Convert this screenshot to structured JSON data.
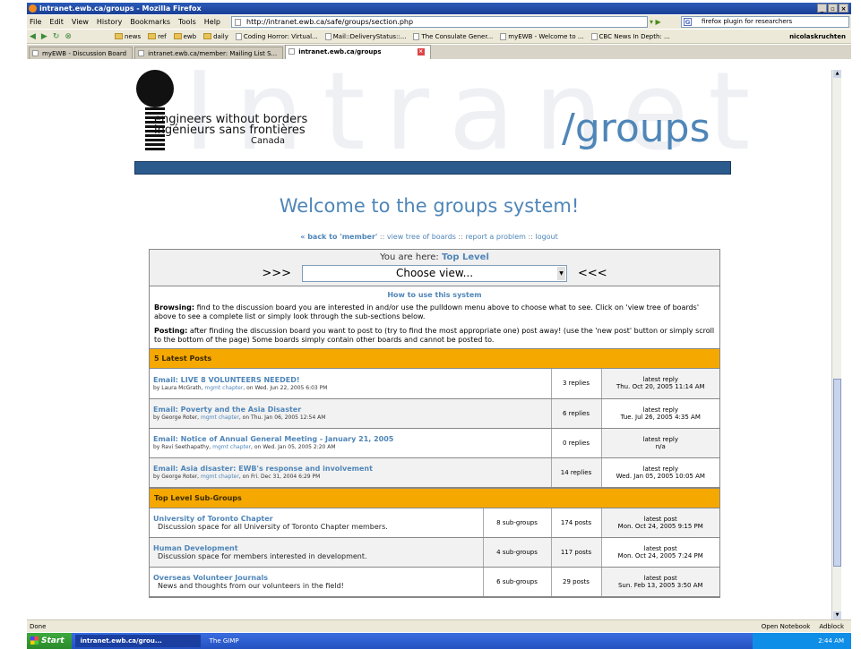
{
  "browser": {
    "window_title": "intranet.ewb.ca/groups - Mozilla Firefox",
    "menu": [
      "File",
      "Edit",
      "View",
      "History",
      "Bookmarks",
      "Tools",
      "Help"
    ],
    "url": "http://intranet.ewb.ca/safe/groups/section.php",
    "search_placeholder": "firefox plugin for researchers",
    "bookmarks": [
      "news",
      "ref",
      "ewb",
      "daily",
      "Coding Horror: Virtual...",
      "Mail::DeliveryStatus::...",
      "The Consulate Gener...",
      "myEWB - Welcome to ...",
      "CBC News In Depth: ..."
    ],
    "user": "nicolaskruchten",
    "tabs": [
      "myEWB - Discussion Board",
      "intranet.ewb.ca/member: Mailing List S...",
      "intranet.ewb.ca/groups"
    ],
    "status": "Done",
    "status_right": [
      "Open Notebook",
      "Adblock"
    ]
  },
  "header": {
    "watermark": "Intranet",
    "org_en": "engineers without borders",
    "org_fr": "ingénieurs sans frontières",
    "country": "Canada",
    "section": "/groups"
  },
  "page": {
    "welcome": "Welcome to the groups system!",
    "links": {
      "back": "« back to 'member'",
      "tree": "view tree of boards",
      "report": "report a problem",
      "logout": "logout",
      "sep": "::"
    },
    "you_are_here_label": "You are here:",
    "you_are_here_value": "Top Level",
    "arrows_left": ">>>",
    "arrows_right": "<<<",
    "choose_view": "Choose view...",
    "howto_title": "How to use this system",
    "browsing_label": "Browsing:",
    "browsing_text": "find to the discussion board you are interested in and/or use the pulldown menu above to choose what to see. Click on 'view tree of boards' above to see a complete list or simply look through the sub-sections below.",
    "posting_label": "Posting:",
    "posting_text": "after finding the discussion board you want to post to (try to find the most appropriate one) post away! (use the 'new post' button or simply scroll to the bottom of the page) Some boards simply contain other boards and cannot be posted to."
  },
  "latest_posts": {
    "heading": "5 Latest Posts",
    "rows": [
      {
        "title": "Email: LIVE 8 VOLUNTEERS NEEDED!",
        "by": "by Laura McGrath,",
        "chapter": "mgmt chapter",
        "date": ", on Wed. Jun 22, 2005 6:03 PM",
        "replies": "3 replies",
        "latest_label": "latest reply",
        "latest": "Thu. Oct 20, 2005 11:14 AM"
      },
      {
        "title": "Email: Poverty and the Asia Disaster",
        "by": "by George Roter,",
        "chapter": "mgmt chapter",
        "date": ", on Thu. Jan 06, 2005 12:54 AM",
        "replies": "6 replies",
        "latest_label": "latest reply",
        "latest": "Tue. Jul 26, 2005 4:35 AM"
      },
      {
        "title": "Email: Notice of Annual General Meeting - January 21, 2005",
        "by": "by Ravi Seethapathy,",
        "chapter": "mgmt chapter",
        "date": ", on Wed. Jan 05, 2005 2:20 AM",
        "replies": "0 replies",
        "latest_label": "latest reply",
        "latest": "n/a"
      },
      {
        "title": "Email: Asia disaster: EWB's response and involvement",
        "by": "by George Roter,",
        "chapter": "mgmt chapter",
        "date": ", on Fri. Dec 31, 2004 6:29 PM",
        "replies": "14 replies",
        "latest_label": "latest reply",
        "latest": "Wed. Jan 05, 2005 10:05 AM"
      }
    ]
  },
  "subgroups": {
    "heading": "Top Level Sub-Groups",
    "rows": [
      {
        "title": "University of Toronto Chapter",
        "desc": "Discussion space for all University of Toronto Chapter members.",
        "subgroups": "8 sub-groups",
        "posts": "174 posts",
        "latest_label": "latest post",
        "latest": "Mon. Oct 24, 2005 9:15 PM"
      },
      {
        "title": "Human Development",
        "desc": "Discussion space for members interested in development.",
        "subgroups": "4 sub-groups",
        "posts": "117 posts",
        "latest_label": "latest post",
        "latest": "Mon. Oct 24, 2005 7:24 PM"
      },
      {
        "title": "Overseas Volunteer Journals",
        "desc": "News and thoughts from our volunteers in the field!",
        "subgroups": "6 sub-groups",
        "posts": "29 posts",
        "latest_label": "latest post",
        "latest": "Sun. Feb 13, 2005 3:50 AM"
      }
    ]
  },
  "taskbar": {
    "start": "Start",
    "tasks": [
      "intranet.ewb.ca/grou...",
      "The GIMP"
    ],
    "clock": "2:44 AM"
  }
}
